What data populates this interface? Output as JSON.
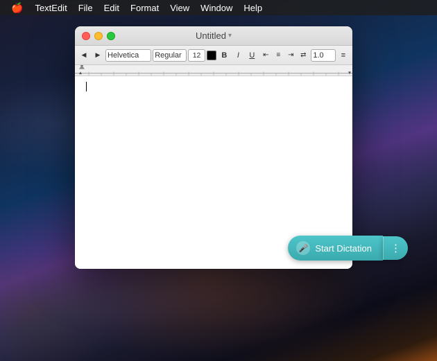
{
  "desktop": {
    "label": "macOS Desktop"
  },
  "menubar": {
    "apple": "🍎",
    "items": [
      {
        "id": "textedit",
        "label": "TextEdit",
        "active": false
      },
      {
        "id": "file",
        "label": "File",
        "active": false
      },
      {
        "id": "edit",
        "label": "Edit",
        "active": false
      },
      {
        "id": "format",
        "label": "Format",
        "active": false
      },
      {
        "id": "view",
        "label": "View",
        "active": false
      },
      {
        "id": "window",
        "label": "Window",
        "active": false
      },
      {
        "id": "help",
        "label": "Help",
        "active": false
      }
    ]
  },
  "window": {
    "title": "Untitled",
    "title_chevron": "▾"
  },
  "toolbar": {
    "font_family": "Helvetica",
    "font_style": "Regular",
    "font_size": "12",
    "bold": "B",
    "italic": "I",
    "underline": "U",
    "line_spacing": "1.0",
    "list_icon": "≡"
  },
  "dictation": {
    "button_label": "Start Dictation",
    "more_icon": "⋮",
    "mic_icon": "🎤"
  }
}
